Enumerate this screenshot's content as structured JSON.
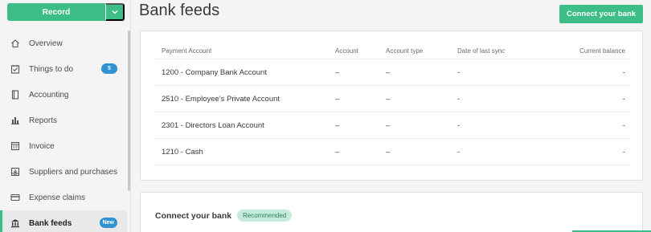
{
  "sidebar": {
    "record_label": "Record",
    "items": [
      {
        "label": "Overview",
        "icon": "home-icon"
      },
      {
        "label": "Things to do",
        "icon": "checklist-icon",
        "badge": "5"
      },
      {
        "label": "Accounting",
        "icon": "book-icon"
      },
      {
        "label": "Reports",
        "icon": "bar-chart-icon"
      },
      {
        "label": "Invoice",
        "icon": "invoice-icon"
      },
      {
        "label": "Suppliers and purchases",
        "icon": "inbox-icon"
      },
      {
        "label": "Expense claims",
        "icon": "card-icon"
      },
      {
        "label": "Bank feeds",
        "icon": "bank-icon",
        "badge": "New",
        "active": true
      }
    ]
  },
  "header": {
    "title": "Bank feeds",
    "connect_button": "Connect your bank"
  },
  "table": {
    "columns": [
      "Payment Account",
      "Account",
      "Account type",
      "Date of last sync",
      "Current balance"
    ],
    "rows": [
      [
        "1200 - Company Bank Account",
        "–",
        "–",
        "-",
        "-"
      ],
      [
        "2510 - Employee's Private Account",
        "–",
        "–",
        "-",
        "-"
      ],
      [
        "2301 - Directors Loan Account",
        "–",
        "–",
        "-",
        "-"
      ],
      [
        "1210 - Cash",
        "–",
        "–",
        "-",
        "-"
      ]
    ]
  },
  "connect_section": {
    "title": "Connect your bank",
    "badge": "Recommended"
  },
  "colors": {
    "accent": "#3dbd87",
    "badge_blue": "#3091d3"
  }
}
